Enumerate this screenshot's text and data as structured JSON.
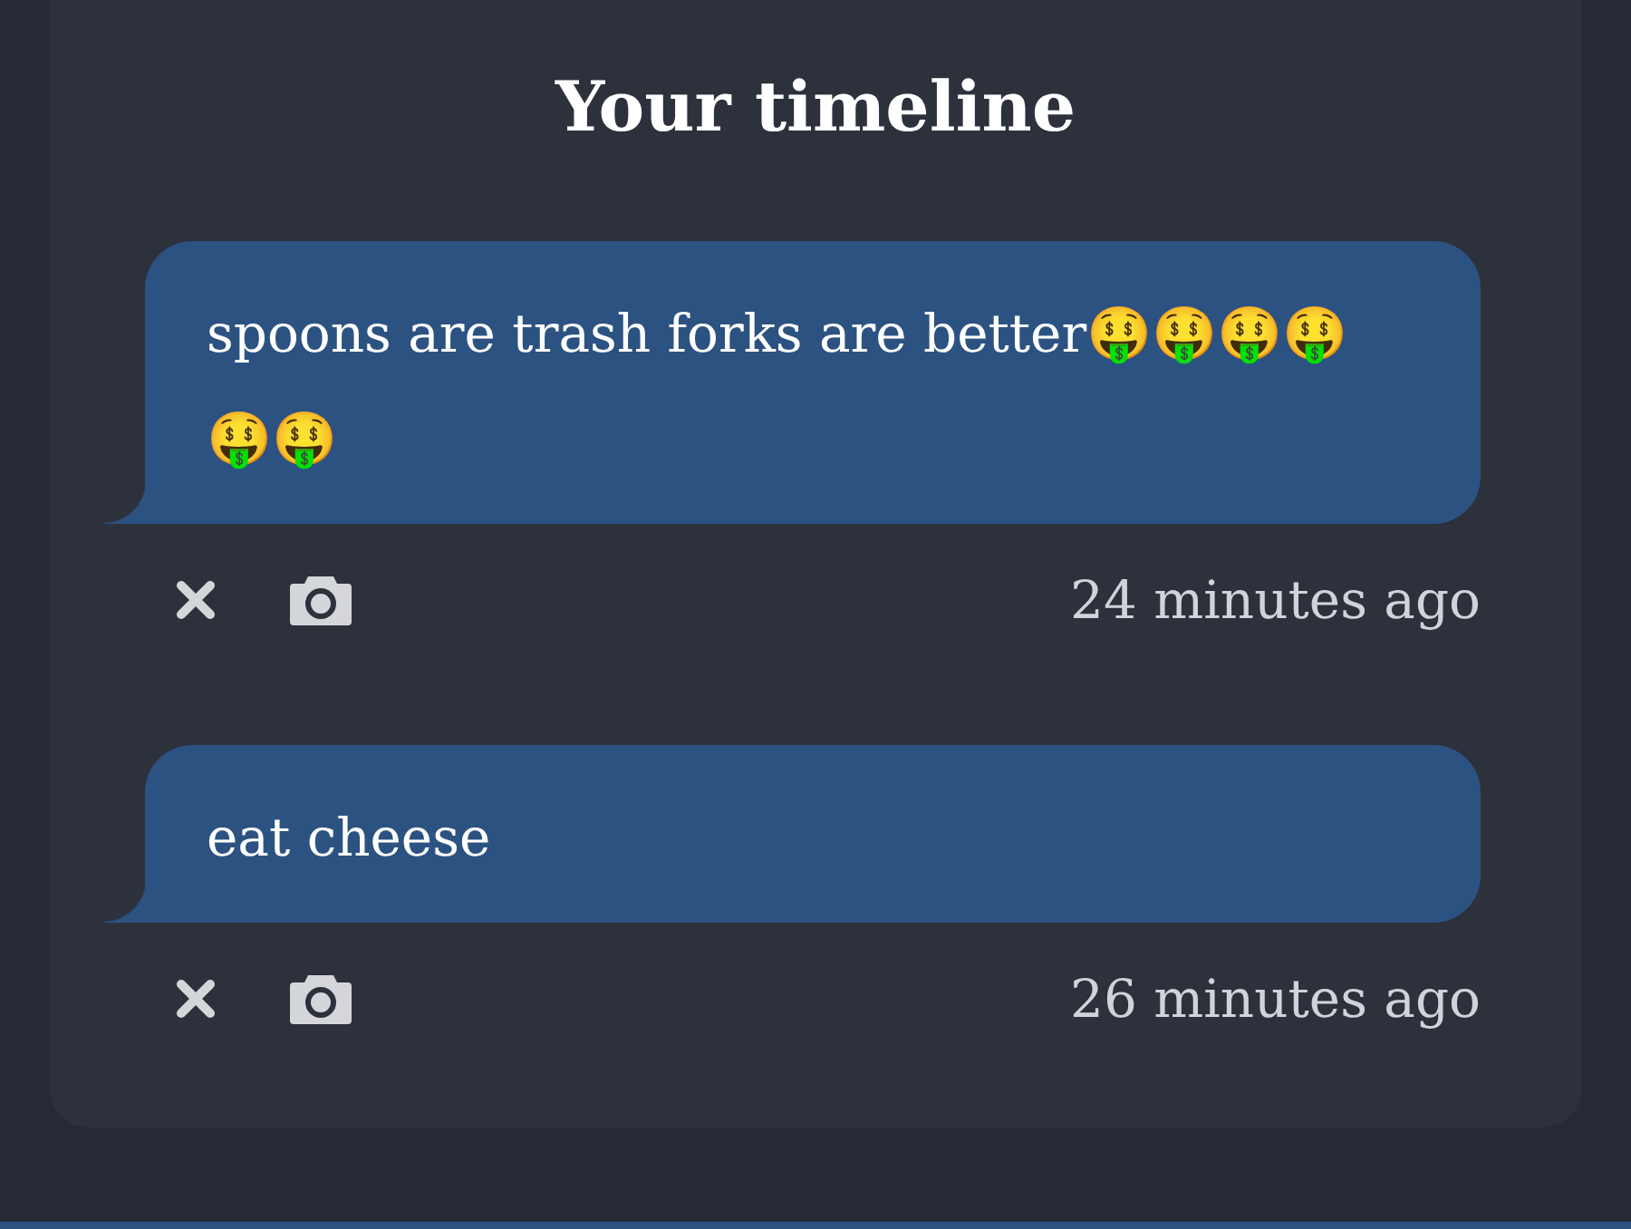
{
  "title": "Your timeline",
  "posts": [
    {
      "text": "spoons are trash forks are better🤑🤑🤑🤑🤑🤑",
      "time": "24 minutes ago"
    },
    {
      "text": "eat cheese",
      "time": "26 minutes ago"
    }
  ]
}
